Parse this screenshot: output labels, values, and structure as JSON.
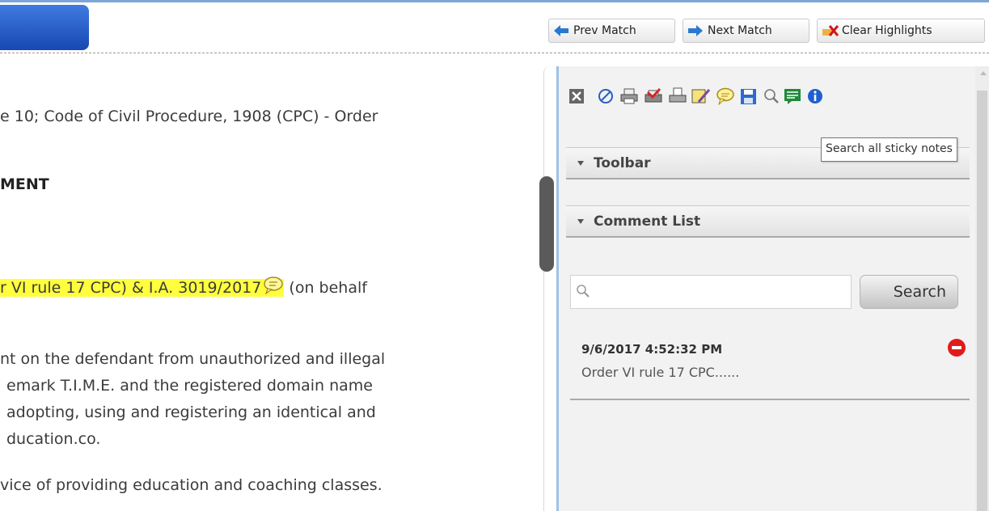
{
  "toolbar": {
    "prev_match": "Prev Match",
    "next_match": "Next Match",
    "clear_highlights": "Clear Highlights"
  },
  "document": {
    "lines": [
      "e 10; Code of Civil Procedure, 1908 (CPC) - Order",
      "MENT",
      "r VI rule 17 CPC) & I.A. 3019/2017",
      " (on behalf",
      "nt on the defendant from unauthorized and illegal",
      "emark T.I.M.E. and the registered domain name",
      "adopting, using and registering an identical and",
      "ducation.co.",
      "vice of providing education and coaching classes."
    ]
  },
  "panel": {
    "icons": [
      "close-icon",
      "cancel-icon",
      "print-icon",
      "sign-icon",
      "print-preview-icon",
      "sticky-note-edit-icon",
      "comment-icon",
      "save-icon",
      "search-sticky-notes-icon",
      "notes-list-icon",
      "info-icon"
    ],
    "tooltip": "Search all sticky notes",
    "toolbar_section": "Toolbar",
    "comment_list_section": "Comment List",
    "search_placeholder": "",
    "search_button": "Search",
    "comments": [
      {
        "timestamp": "9/6/2017 4:52:32 PM",
        "text": "Order VI rule 17 CPC......"
      }
    ]
  },
  "colors": {
    "highlight": "#ffff3d",
    "accent": "#1f56c4",
    "delete": "#e11b1b"
  }
}
